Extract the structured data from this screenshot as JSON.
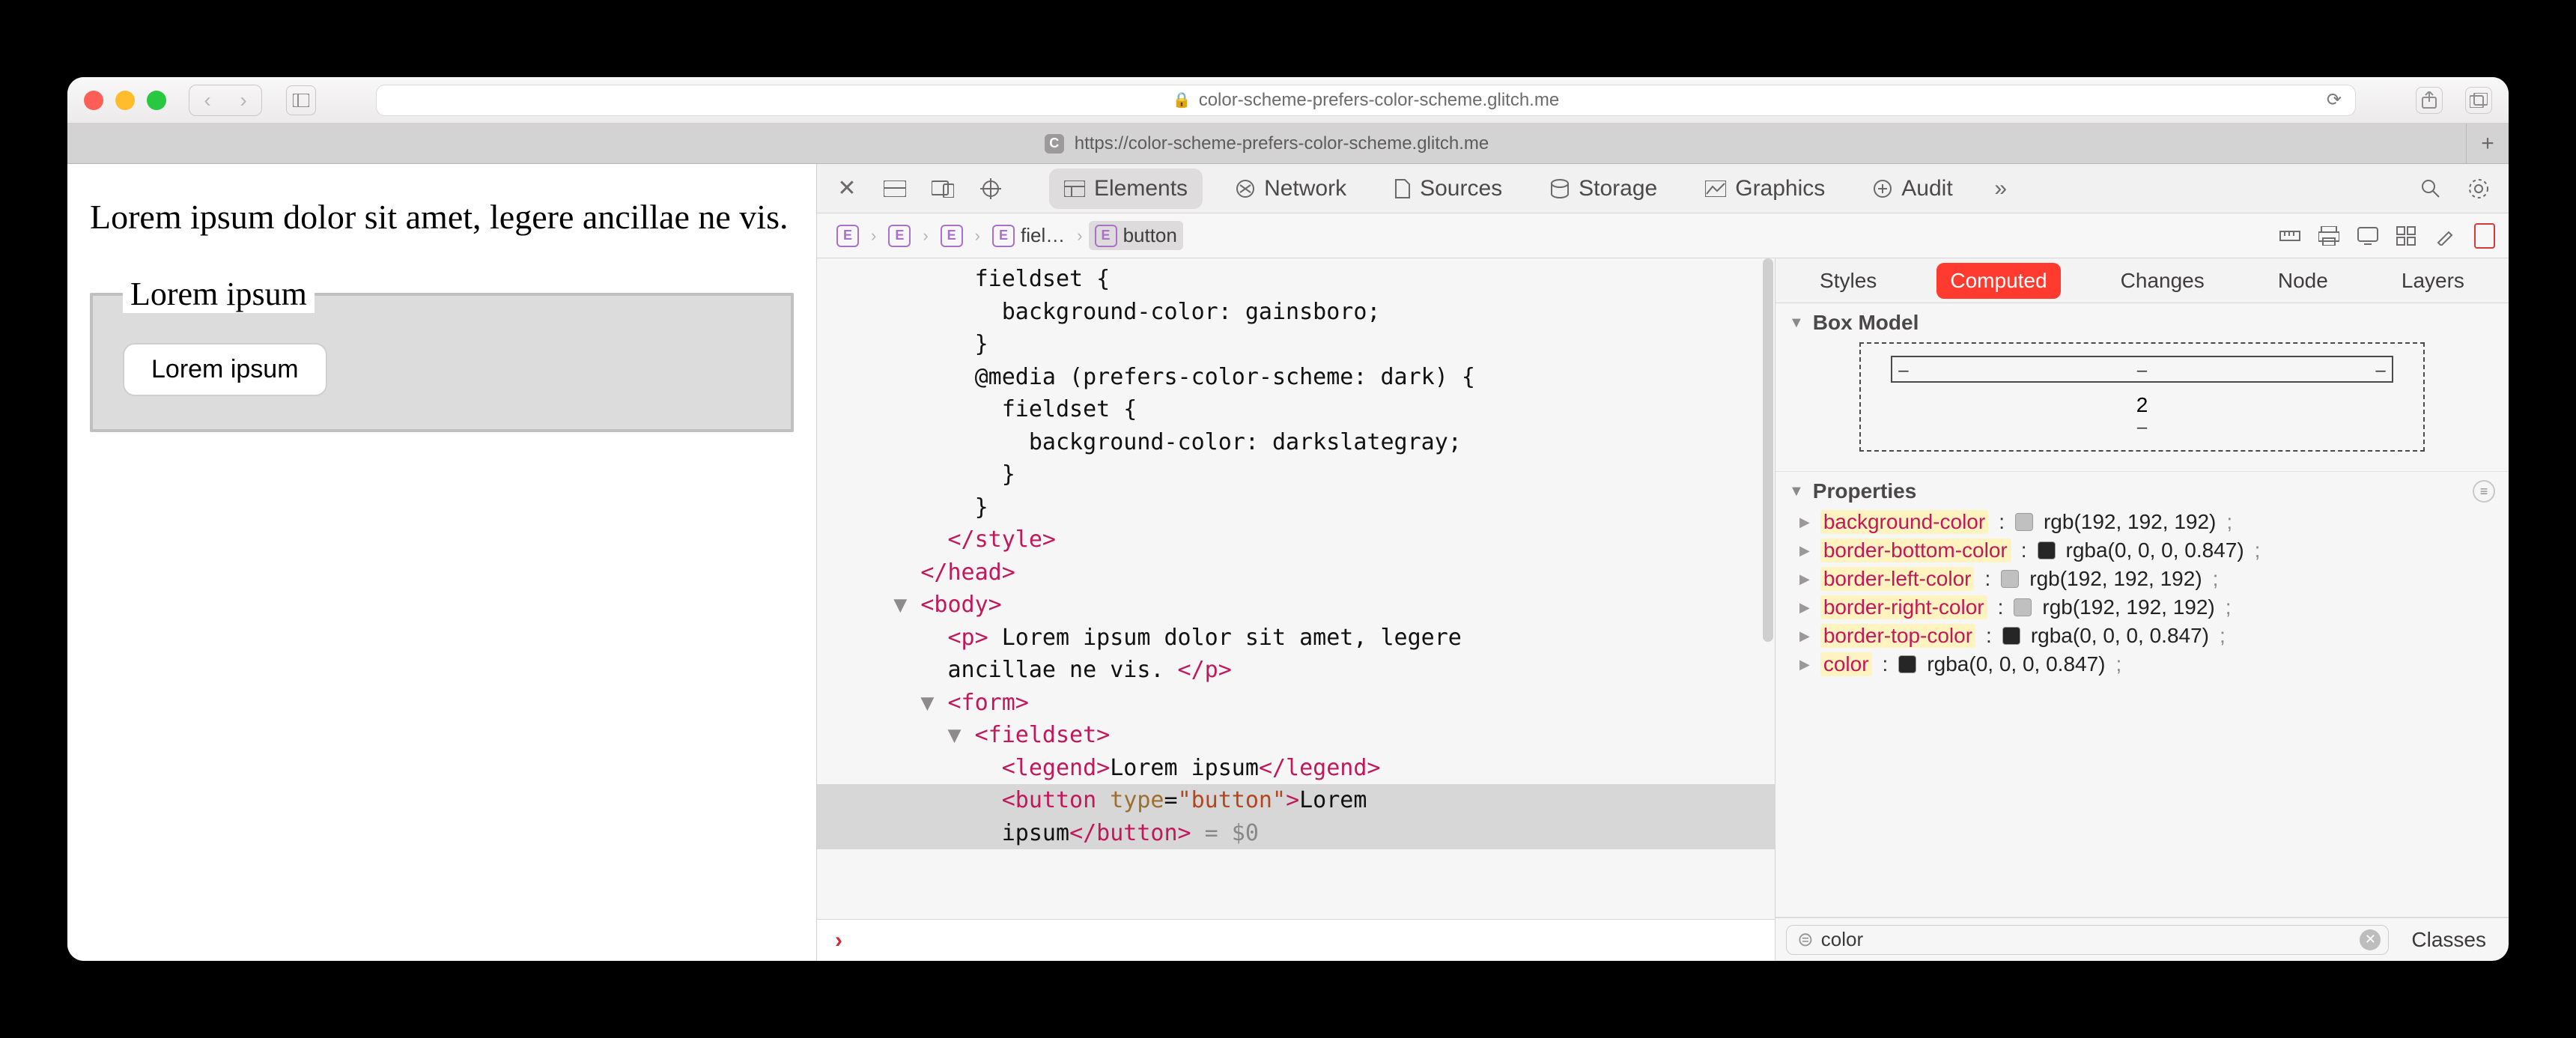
{
  "titlebar": {
    "url_display": "color-scheme-prefers-color-scheme.glitch.me",
    "lock_icon": "lock"
  },
  "tabbar": {
    "favicon_letter": "C",
    "tab_url": "https://color-scheme-prefers-color-scheme.glitch.me"
  },
  "page": {
    "paragraph": "Lorem ipsum dolor sit amet, legere ancillae ne vis.",
    "legend": "Lorem ipsum",
    "button": "Lorem ipsum"
  },
  "devtools": {
    "tabs": {
      "elements": "Elements",
      "network": "Network",
      "sources": "Sources",
      "storage": "Storage",
      "graphics": "Graphics",
      "audit": "Audit"
    },
    "breadcrumb": {
      "b3_label": "fiel…",
      "b4_label": "button"
    },
    "dom": {
      "l1": "          fieldset {",
      "l2": "            background-color: gainsboro;",
      "l3": "          }",
      "l4": "          @media (prefers-color-scheme: dark) {",
      "l5": "            fieldset {",
      "l6": "              background-color: darkslategray;",
      "l7": "            }",
      "l8": "          }",
      "style_close": "</style>",
      "head_close": "</head>",
      "body_open": "<body>",
      "p_open": "<p>",
      "p_text": " Lorem ipsum dolor sit amet, legere ",
      "p_text2": "ancillae ne vis. ",
      "p_close": "</p>",
      "form_open": "<form>",
      "fieldset_open": "<fieldset>",
      "legend_open": "<legend>",
      "legend_text": "Lorem ipsum",
      "legend_close": "</legend>",
      "button_open": "<button ",
      "button_attr": "type",
      "button_eq": "=",
      "button_val": "\"button\"",
      "button_open_end": ">",
      "button_text_a": "Lorem ",
      "button_text_b": "ipsum",
      "button_close": "</button>",
      "sel_suffix": " = $0"
    },
    "right": {
      "tabs": {
        "styles": "Styles",
        "computed": "Computed",
        "changes": "Changes",
        "node": "Node",
        "layers": "Layers"
      },
      "box_model_label": "Box Model",
      "box_model_value": "2",
      "properties_label": "Properties",
      "props": [
        {
          "name": "background-color",
          "swatch": "#c0c0c0",
          "value": "rgb(192, 192, 192)"
        },
        {
          "name": "border-bottom-color",
          "swatch": "#000000d8",
          "value": "rgba(0, 0, 0, 0.847)"
        },
        {
          "name": "border-left-color",
          "swatch": "#c0c0c0",
          "value": "rgb(192, 192, 192)"
        },
        {
          "name": "border-right-color",
          "swatch": "#c0c0c0",
          "value": "rgb(192, 192, 192)"
        },
        {
          "name": "border-top-color",
          "swatch": "#000000d8",
          "value": "rgba(0, 0, 0, 0.847)"
        },
        {
          "name": "color",
          "swatch": "#000000d8",
          "value": "rgba(0, 0, 0, 0.847)"
        }
      ],
      "filter_value": "color",
      "classes_label": "Classes"
    }
  }
}
